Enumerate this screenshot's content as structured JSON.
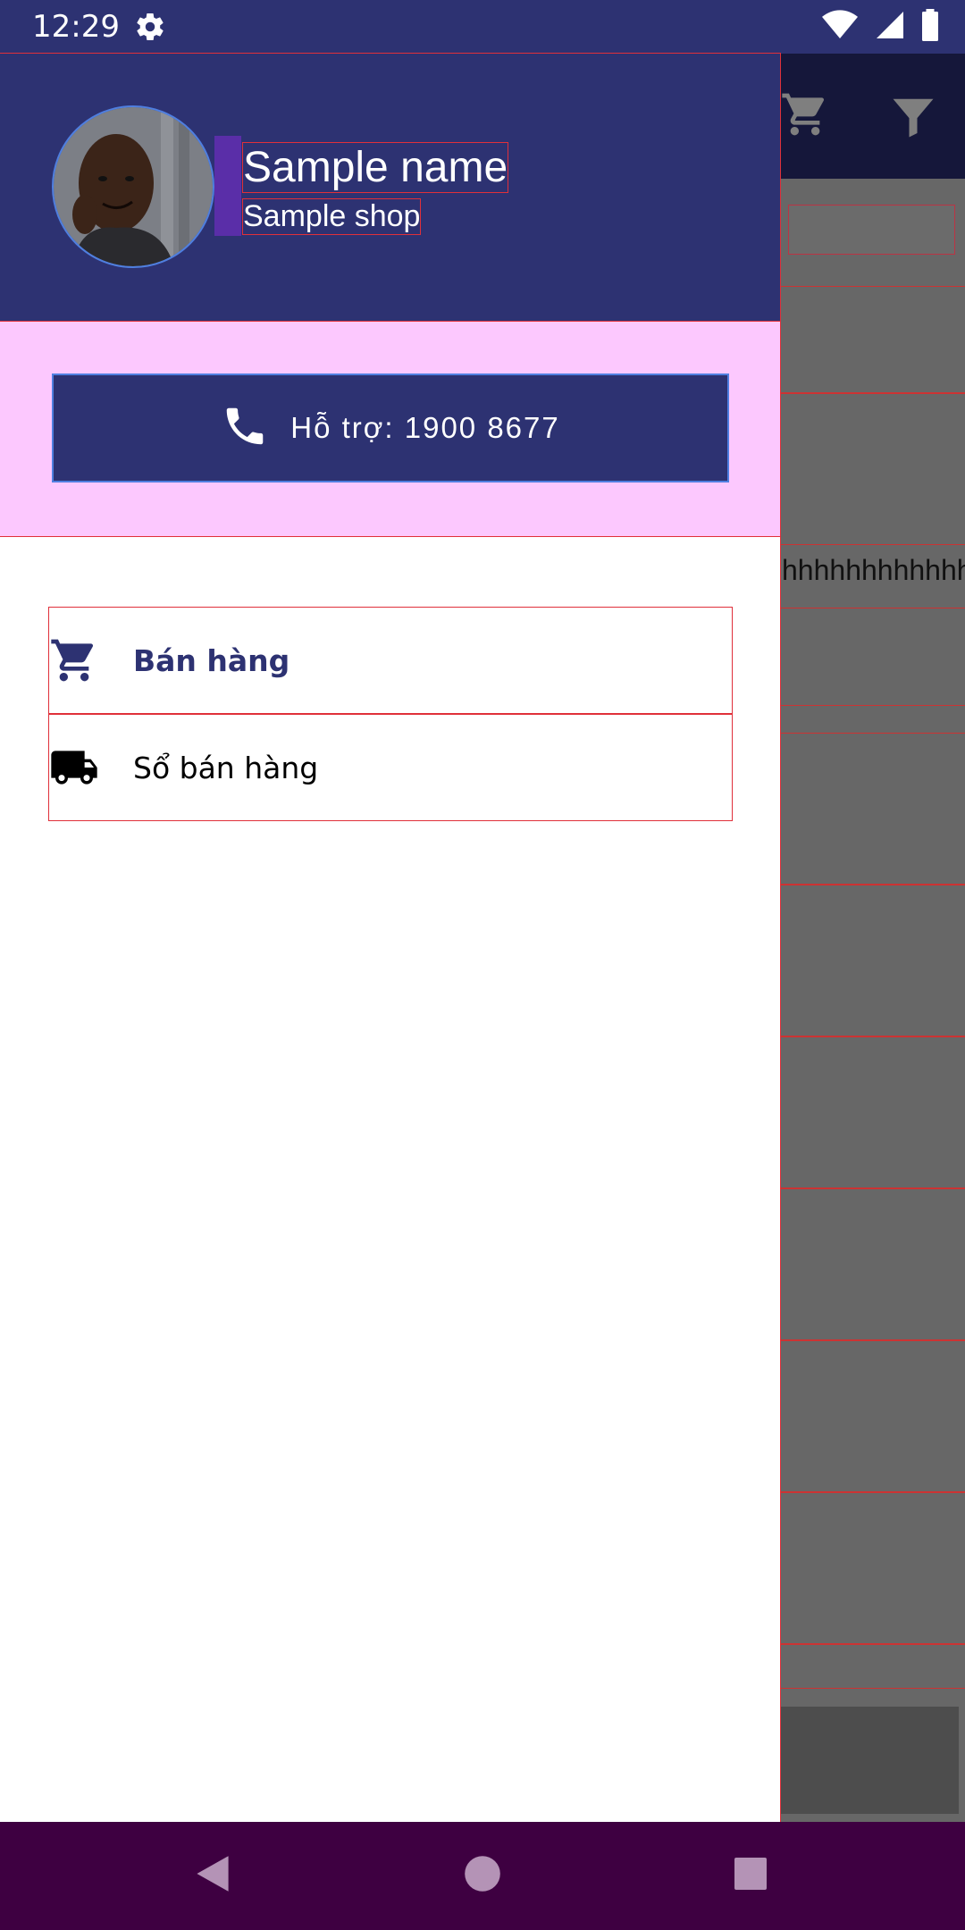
{
  "status_bar": {
    "time": "12:29",
    "icons": [
      "gear-icon",
      "wifi-icon",
      "cell-signal-icon",
      "battery-icon"
    ]
  },
  "drawer": {
    "profile": {
      "name": "Sample name",
      "shop": "Sample shop",
      "avatar": "avatar-photo"
    },
    "support_button": {
      "label": "Hỗ trợ: 1900 8677",
      "icon": "phone-icon"
    },
    "menu": [
      {
        "label": "Bán hàng",
        "icon": "cart-icon",
        "selected": true
      },
      {
        "label": "Sổ bán hàng",
        "icon": "truck-icon",
        "selected": false
      }
    ]
  },
  "background_app": {
    "visible_text": "hhhhhhhhhhhh",
    "toolbar_icons": [
      "cart-icon",
      "filter-icon"
    ]
  },
  "nav_bar": {
    "buttons": [
      "back-icon",
      "home-icon",
      "recents-icon"
    ]
  },
  "colors": {
    "primary": "#2d3272",
    "accent_pink": "#fcc8fe",
    "nav_bar": "#3e0041",
    "scrim_gray": "#676767"
  }
}
